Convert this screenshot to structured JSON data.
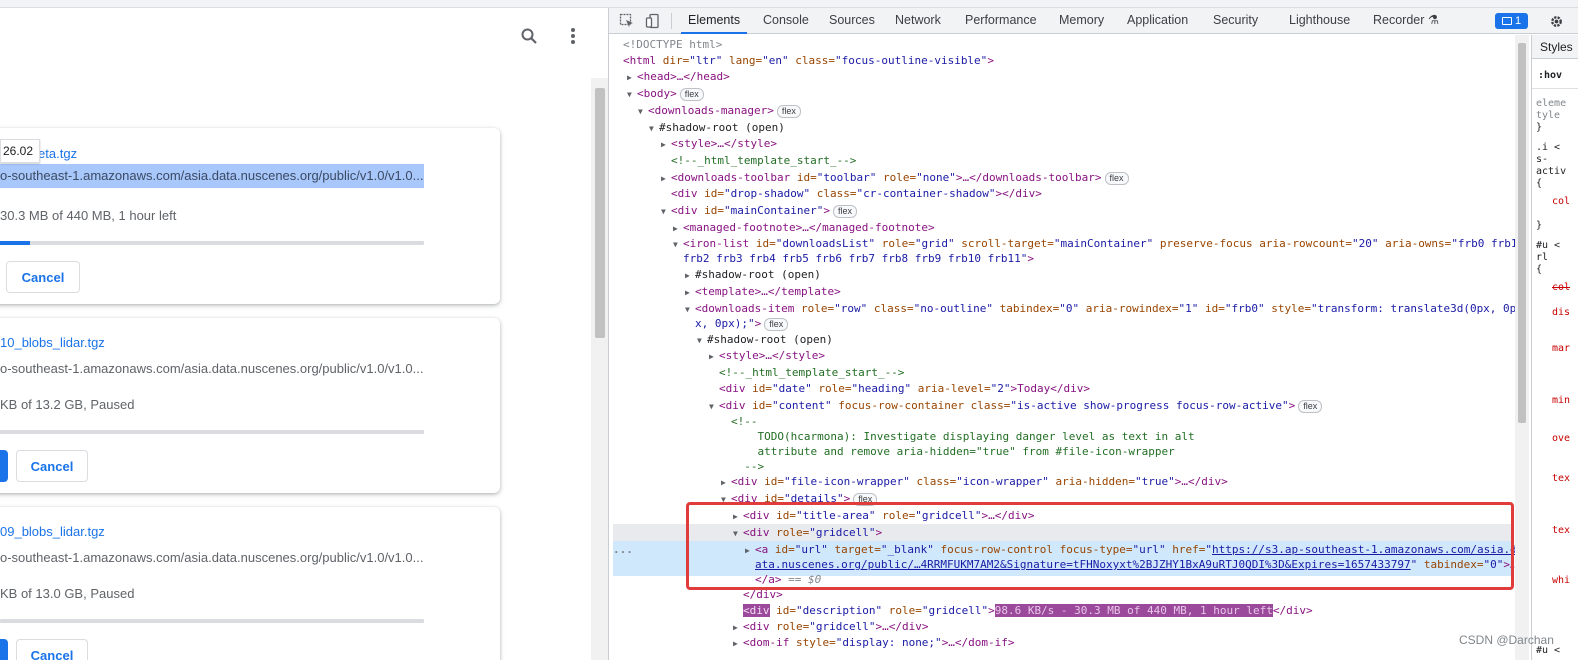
{
  "left_pane": {
    "tooltip": "26.02",
    "downloads": [
      {
        "name": "_meta.tgz",
        "url": "o-southeast-1.amazonaws.com/asia.data.nuscenes.org/public/v1.0/v1.0...",
        "status": "30.3 MB of 440 MB, 1 hour left",
        "button": "Cancel",
        "progress": 0.07
      },
      {
        "name": "10_blobs_lidar.tgz",
        "url": "o-southeast-1.amazonaws.com/asia.data.nuscenes.org/public/v1.0/v1.0...",
        "status": "KB of 13.2 GB, Paused",
        "button": "Cancel",
        "progress": 0.0
      },
      {
        "name": "09_blobs_lidar.tgz",
        "url": "o-southeast-1.amazonaws.com/asia.data.nuscenes.org/public/v1.0/v1.0...",
        "status": "KB of 13.0 GB, Paused",
        "button": "Cancel",
        "progress": 0.0
      }
    ]
  },
  "devtools": {
    "tabs": [
      "Elements",
      "Console",
      "Sources",
      "Network",
      "Performance",
      "Memory",
      "Application",
      "Security",
      "Lighthouse",
      "Recorder ⚗"
    ],
    "active_tab": "Elements",
    "issues_count": "1",
    "styles_tab": "Styles",
    "dom": {
      "doctype": "<!DOCTYPE html>",
      "html_tag": "<html",
      "html_dir": " dir=",
      "html_dir_v": "\"ltr\"",
      "html_lang": " lang=",
      "html_lang_v": "\"en\"",
      "html_class": " class=",
      "html_class_v": "\"focus-outline-visible\"",
      "head": "<head>…</head>",
      "body": "<body>",
      "flex": "flex",
      "downloads_manager": "<downloads-manager>",
      "shadow_root": "#shadow-root (open)",
      "style_collapsed": "<style>…</style>",
      "comment_template": "<!--_html_template_start_-->",
      "toolbar_open": "<downloads-toolbar",
      "toolbar_attrs_id": " id=",
      "toolbar_attrs_id_v": "\"toolbar\"",
      "toolbar_role": " role=",
      "toolbar_role_v": "\"none\"",
      "toolbar_close": ">…</downloads-toolbar>",
      "drop_shadow_open": "<div",
      "drop_shadow_id": " id=",
      "drop_shadow_id_v": "\"drop-shadow\"",
      "drop_shadow_class": " class=",
      "drop_shadow_class_v": "\"cr-container-shadow\"",
      "drop_shadow_close": "></div>",
      "main_open": "<div",
      "main_id": " id=",
      "main_id_v": "\"mainContainer\"",
      "main_close": ">",
      "footnote": "<managed-footnote>…</managed-footnote>",
      "ironlist_open": "<iron-list",
      "ironlist_id": " id=",
      "ironlist_id_v": "\"downloadsList\"",
      "ironlist_role": " role=",
      "ironlist_role_v": "\"grid\"",
      "ironlist_st": " scroll-target=",
      "ironlist_st_v": "\"mainContainer\"",
      "ironlist_pf": " preserve-focus",
      "ironlist_rc": " aria-rowcount=",
      "ironlist_rc_v": "\"20\"",
      "ironlist_ao": " aria-owns=",
      "ironlist_ao_v": "\"frb0 frb1",
      "ironlist_ao_v2": "frb2 frb3 frb4 frb5 frb6 frb7 frb8 frb9 frb10 frb11\"",
      "ironlist_end": ">",
      "template": "<template>…</template>",
      "ditem_open": "<downloads-item",
      "ditem_role": " role=",
      "ditem_role_v": "\"row\"",
      "ditem_class": " class=",
      "ditem_class_v": "\"no-outline\"",
      "ditem_ti": " tabindex=",
      "ditem_ti_v": "\"0\"",
      "ditem_ari": " aria-rowindex=",
      "ditem_ari_v": "\"1\"",
      "ditem_id": " id=",
      "ditem_id_v": "\"frb0\"",
      "ditem_style": " style=",
      "ditem_style_v": "\"transform: translate3d(0px, 0p",
      "ditem_style_v2": "x, 0px);\"",
      "ditem_end": ">",
      "date_open": "<div",
      "date_id": " id=",
      "date_id_v": "\"date\"",
      "date_role": " role=",
      "date_role_v": "\"heading\"",
      "date_al": " aria-level=",
      "date_al_v": "\"2\"",
      "date_text": ">Today</div>",
      "content_open": "<div",
      "content_id": " id=",
      "content_id_v": "\"content\"",
      "content_frc": " focus-row-container",
      "content_class": " class=",
      "content_class_v": "\"is-active show-progress focus-row-active\"",
      "content_end": ">",
      "todo_open": "<!--",
      "todo_1": "    TODO(hcarmona): Investigate displaying danger level as text in alt",
      "todo_2": "    attribute and remove aria-hidden=\"true\" from #file-icon-wrapper",
      "todo_close": "  -->",
      "fiw_open": "<div",
      "fiw_id": " id=",
      "fiw_id_v": "\"file-icon-wrapper\"",
      "fiw_class": " class=",
      "fiw_class_v": "\"icon-wrapper\"",
      "fiw_ah": " aria-hidden=",
      "fiw_ah_v": "\"true\"",
      "fiw_close": ">…</div>",
      "details_open": "<div",
      "details_id": " id=",
      "details_id_v": "\"details\"",
      "details_end": ">",
      "ta_open": "<div",
      "ta_id": " id=",
      "ta_id_v": "\"title-area\"",
      "ta_role": " role=",
      "ta_role_v": "\"gridcell\"",
      "ta_close": ">…</div>",
      "gc_open": "<div",
      "gc_role": " role=",
      "gc_role_v": "\"gridcell\"",
      "gc_end": ">",
      "a_open": "<a",
      "a_id": " id=",
      "a_id_v": "\"url\"",
      "a_target": " target=",
      "a_target_v": "\"_blank\"",
      "a_fr": " focus-row-control",
      "a_ft": " focus-type=",
      "a_ft_v": "\"url\"",
      "a_href": " href=",
      "a_href_v": "https://s3.ap-southeast-1.amazonaws.com/asia.d",
      "a_href_v2": "ata.nuscenes.org/public/…4RRMFUKM7AM2&Signature=tFHNoxyxt%2BJZHY1BxA9uRTJ0QDI%3D&Expires=1657433797",
      "a_ti": " tabindex=",
      "a_ti_v": "\"0\"",
      "a_more": ">…",
      "a_close": "</a>",
      "a_eq": " == $0",
      "div_close": "</div>",
      "desc_open": "<div",
      "desc_id": " id=",
      "desc_id_v": "\"description\"",
      "desc_role": " role=",
      "desc_role_v": "\"gridcell\"",
      "desc_gt": ">",
      "desc_text": "98.6 KB/s - 30.3 MB of 440 MB, 1 hour left",
      "desc_close": "</div>",
      "gc2": "<div",
      "gc2_role": " role=",
      "gc2_role_v": "\"gridcell\"",
      "gc2_close": ">…</div>",
      "domif_open": "<dom-if",
      "domif_style": " style=",
      "domif_style_v": "\"display: none;\"",
      "domif_close": ">…</dom-if>",
      "ellipsis": "..."
    },
    "styles_text": [
      ":hov",
      "eleme",
      "tyle",
      "}",
      ".i  <",
      "s-",
      "activ",
      "{",
      "col",
      "}",
      "#u  <",
      "rl",
      "{",
      "col",
      "dis",
      "mar",
      "min",
      "ove",
      "tex",
      "tex",
      "whi",
      "#u  <"
    ]
  },
  "watermark": "CSDN @Darchan"
}
